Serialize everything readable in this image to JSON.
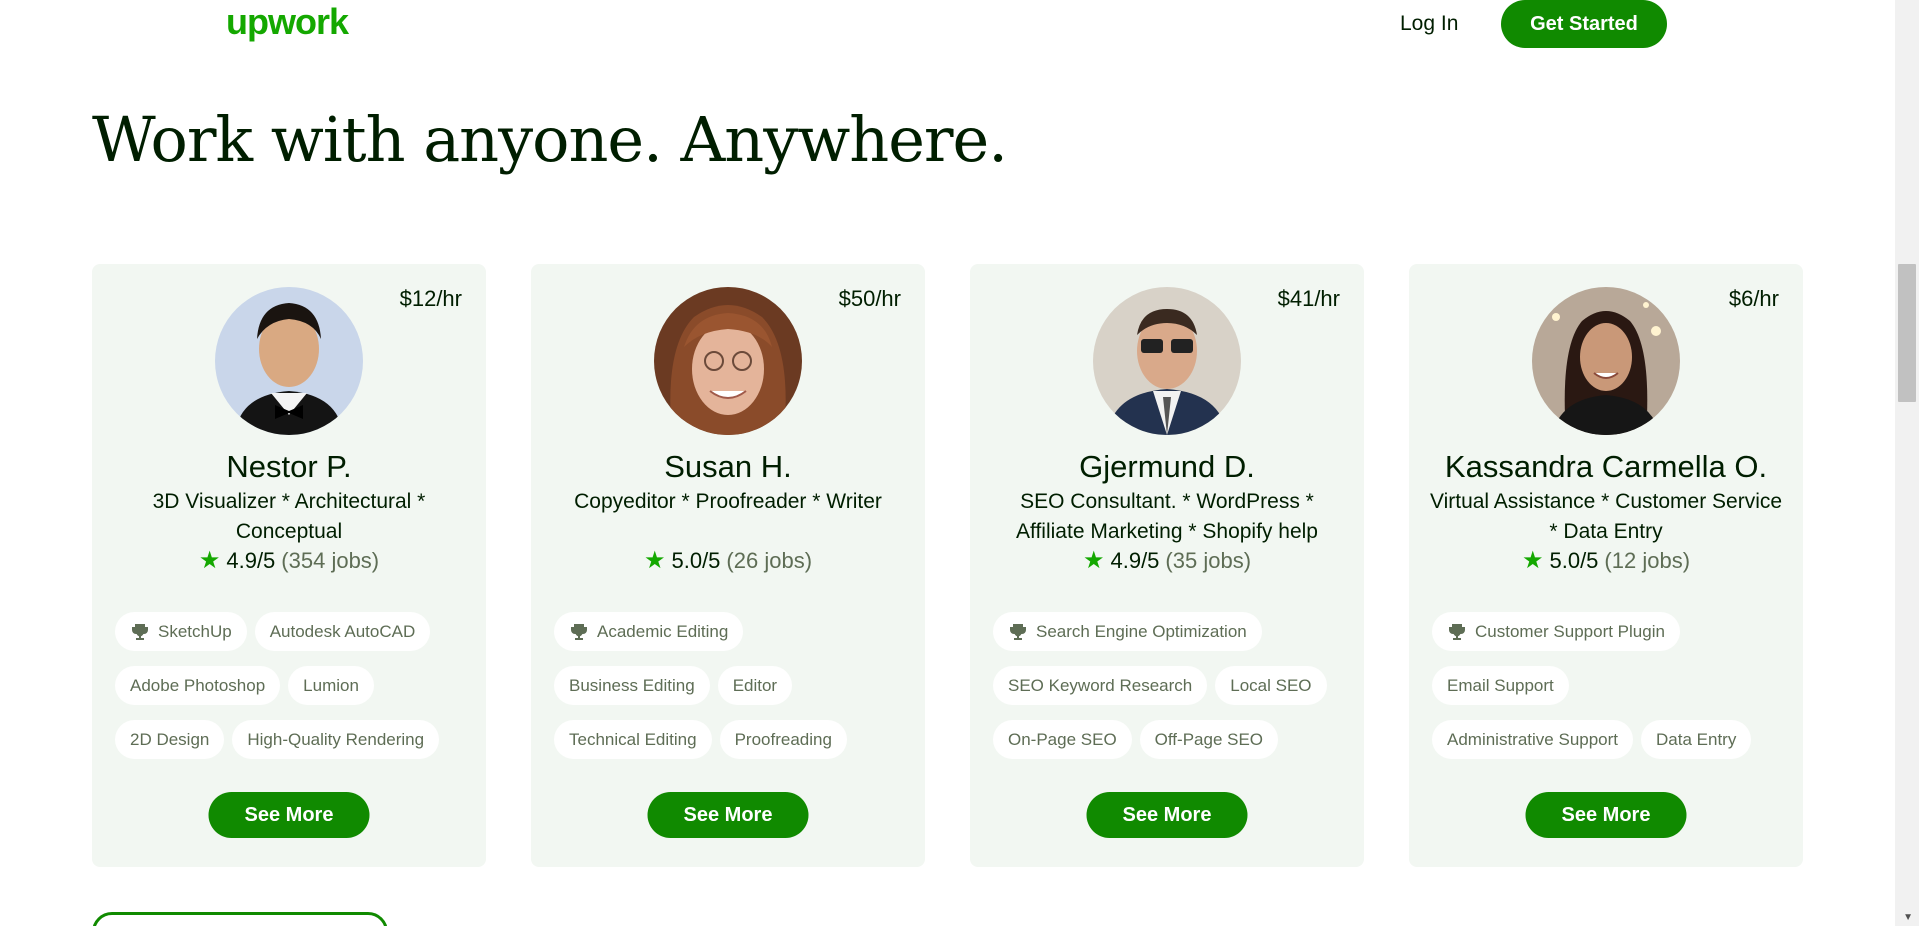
{
  "header": {
    "logo": "upwork",
    "login_label": "Log In",
    "get_started_label": "Get Started"
  },
  "headline": "Work with anyone. Anywhere.",
  "cards": [
    {
      "rate": "$12/hr",
      "name": "Nestor P.",
      "title": "3D Visualizer * Architectural * Conceptual",
      "score": "4.9/5",
      "jobs": "(354 jobs)",
      "skills": [
        [
          "SketchUp",
          "Autodesk AutoCAD"
        ],
        [
          "Adobe Photoshop",
          "Lumion"
        ],
        [
          "2D Design",
          "High-Quality Rendering"
        ]
      ],
      "see_more": "See More"
    },
    {
      "rate": "$50/hr",
      "name": "Susan H.",
      "title": "Copyeditor * Proofreader * Writer",
      "score": "5.0/5",
      "jobs": "(26 jobs)",
      "skills": [
        [
          "Academic Editing"
        ],
        [
          "Business Editing",
          "Editor"
        ],
        [
          "Technical Editing",
          "Proofreading"
        ]
      ],
      "see_more": "See More"
    },
    {
      "rate": "$41/hr",
      "name": "Gjermund D.",
      "title": "SEO Consultant. * WordPress * Affiliate Marketing * Shopify help",
      "score": "4.9/5",
      "jobs": "(35 jobs)",
      "skills": [
        [
          "Search Engine Optimization"
        ],
        [
          "SEO Keyword Research",
          "Local SEO"
        ],
        [
          "On-Page SEO",
          "Off-Page SEO"
        ]
      ],
      "see_more": "See More"
    },
    {
      "rate": "$6/hr",
      "name": "Kassandra Carmella O.",
      "title": "Virtual Assistance * Customer Service * Data Entry",
      "score": "5.0/5",
      "jobs": "(12 jobs)",
      "skills": [
        [
          "Customer Support Plugin"
        ],
        [
          "Email Support"
        ],
        [
          "Administrative Support",
          "Data Entry"
        ]
      ],
      "see_more": "See More"
    }
  ],
  "colors": {
    "brand_green": "#14a800",
    "button_green": "#108a00",
    "card_bg": "#f2f7f2"
  }
}
